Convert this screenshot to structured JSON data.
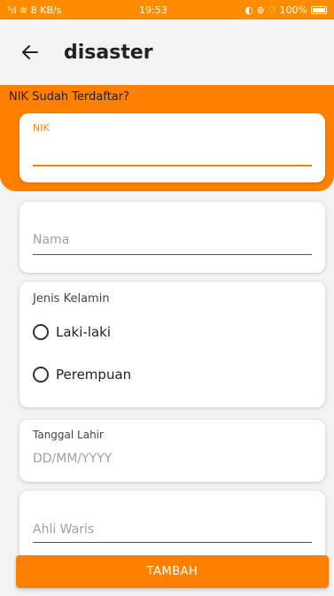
{
  "status_bar": {
    "network": "⁵ıl ≋ 8 KB/s",
    "time": "19:53",
    "icons": "◐ ⊕ ♡ 100%"
  },
  "appbar": {
    "title": "disaster"
  },
  "nik_section": {
    "label": "NIK Sudah Terdaftar?",
    "field_caption": "NIK"
  },
  "fields": {
    "nama_placeholder": "Nama",
    "gender_label": "Jenis Kelamin",
    "gender_options": [
      "Laki-laki",
      "Perempuan"
    ],
    "tanggal_label": "Tanggal Lahir",
    "tanggal_placeholder": "DD/MM/YYYY",
    "ahli_waris_placeholder": "Ahli Waris"
  },
  "button": {
    "label": "TAMBAH"
  },
  "colors": {
    "accent": "#ff8000",
    "background": "#f3f3f3"
  }
}
